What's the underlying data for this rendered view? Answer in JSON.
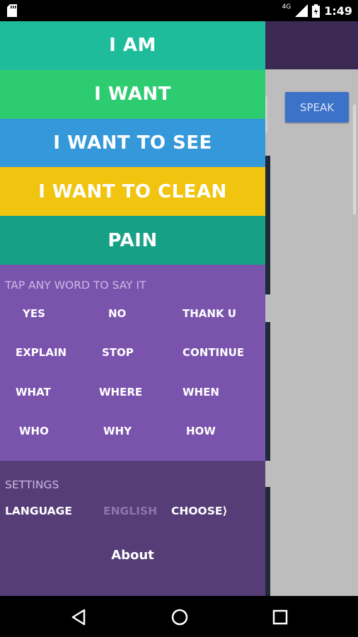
{
  "status": {
    "network": "4G",
    "time": "1:49"
  },
  "app": {
    "speak_label": "SPEAK"
  },
  "drawer": {
    "categories": [
      {
        "label": "I AM",
        "color": "#1fbc9b"
      },
      {
        "label": "I WANT",
        "color": "#2ecc71"
      },
      {
        "label": "I WANT TO SEE",
        "color": "#3498db"
      },
      {
        "label": "I WANT TO CLEAN",
        "color": "#f1c40f"
      },
      {
        "label": "PAIN",
        "color": "#16a085"
      }
    ],
    "phrases_title": "TAP ANY WORD TO SAY IT",
    "words": [
      "YES",
      "NO",
      "THANK U",
      "EXPLAIN",
      "STOP",
      "CONTINUE",
      "WHAT",
      "WHERE",
      "WHEN",
      "WHO",
      "WHY",
      "HOW"
    ],
    "settings": {
      "title": "SETTINGS",
      "language_label": "LANGUAGE",
      "language_value": "ENGLISH",
      "choose_label": "CHOOSE⟩",
      "about_label": "About"
    }
  },
  "navbar": {
    "icons": [
      "back-icon",
      "home-icon",
      "recents-icon"
    ]
  }
}
